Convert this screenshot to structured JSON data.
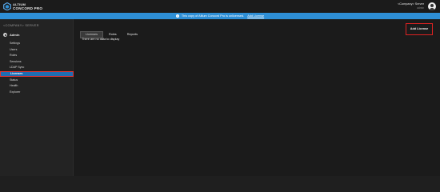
{
  "header": {
    "brand_top": "ALTIUM",
    "brand_bottom": "CONCORD PRO",
    "server_name": "<Company> Server",
    "username": "admin"
  },
  "banner": {
    "message": "This copy of Altium Concord Pro is unlicensed.",
    "link": "Add License"
  },
  "sidebar": {
    "title": "<COMPANY> SERVER",
    "section": "Admin",
    "items": [
      {
        "label": "Settings"
      },
      {
        "label": "Users"
      },
      {
        "label": "Roles"
      },
      {
        "label": "Sessions"
      },
      {
        "label": "LDAP Sync"
      },
      {
        "label": "Licenses"
      },
      {
        "label": "Status"
      },
      {
        "label": "Health"
      },
      {
        "label": "Explorer"
      }
    ],
    "active_index": 5
  },
  "main": {
    "tabs": [
      {
        "label": "Licenses"
      },
      {
        "label": "Roles"
      },
      {
        "label": "Reports"
      }
    ],
    "add_button": "Add License",
    "empty_text": "There are no data to display"
  },
  "colors": {
    "banner": "#2e8fd6",
    "active_nav": "#1f6db3",
    "highlight_border": "#d22"
  }
}
